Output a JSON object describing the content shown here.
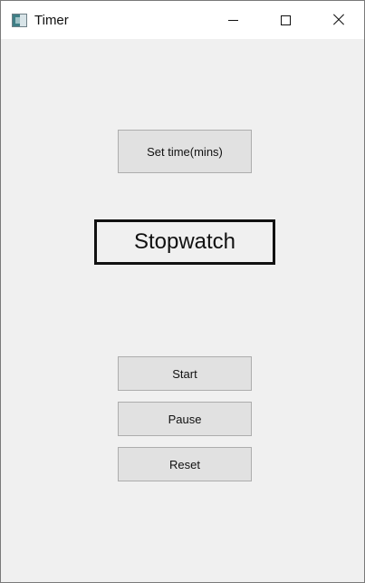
{
  "window": {
    "title": "Timer",
    "icon": "app-window-icon",
    "controls": {
      "minimize_icon": "minimize-icon",
      "maximize_icon": "maximize-icon",
      "close_icon": "close-icon"
    }
  },
  "main": {
    "set_time_label": "Set time(mins)",
    "display_text": "Stopwatch",
    "start_label": "Start",
    "pause_label": "Pause",
    "reset_label": "Reset"
  },
  "colors": {
    "background": "#f0f0f0",
    "button_face": "#e1e1e1",
    "button_border": "#adadad",
    "display_border": "#111111"
  }
}
